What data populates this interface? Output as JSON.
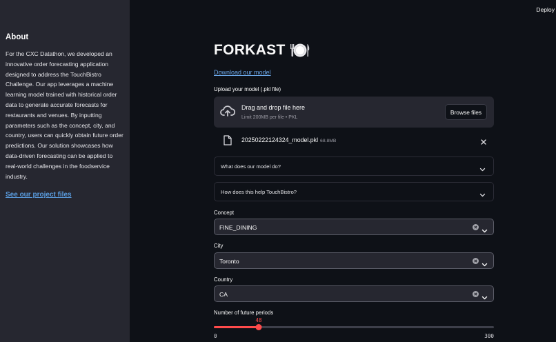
{
  "header": {
    "deploy_label": "Deploy"
  },
  "sidebar": {
    "title": "About",
    "body": "For the CXC Datathon, we developed an innovative order forecasting application designed to address the TouchBistro Challenge. Our app leverages a machine learning model trained with historical order data to generate accurate forecasts for restaurants and venues. By inputting parameters such as the concept, city, and country, users can quickly obtain future order predictions. Our solution showcases how data-driven forecasting can be applied to real-world challenges in the foodservice industry.",
    "link_label": "See our project files"
  },
  "main": {
    "title": "FORKAST",
    "title_icon": "plate-with-cutlery-icon",
    "download_label": "Download our model",
    "upload": {
      "label": "Upload your model (.pkl file)",
      "drop_text": "Drag and drop file here",
      "limit_text": "Limit 200MB per file • PKL",
      "browse_label": "Browse files",
      "file": {
        "name": "20250222124324_model.pkl",
        "size": "68.8MB"
      }
    },
    "expanders": [
      {
        "label": "What does our model do?"
      },
      {
        "label": "How does this help TouchBistro?"
      }
    ],
    "fields": [
      {
        "label": "Concept",
        "value": "FINE_DINING"
      },
      {
        "label": "City",
        "value": "Toronto"
      },
      {
        "label": "Country",
        "value": "CA"
      }
    ],
    "slider": {
      "label": "Number of future periods",
      "value": 48,
      "min": 0,
      "max": 300,
      "min_label": "0",
      "max_label": "300",
      "value_label": "48"
    }
  },
  "colors": {
    "background": "#0e1117",
    "sidebar": "#262730",
    "accent": "#ff4b4b",
    "link": "#6ba7e8"
  }
}
